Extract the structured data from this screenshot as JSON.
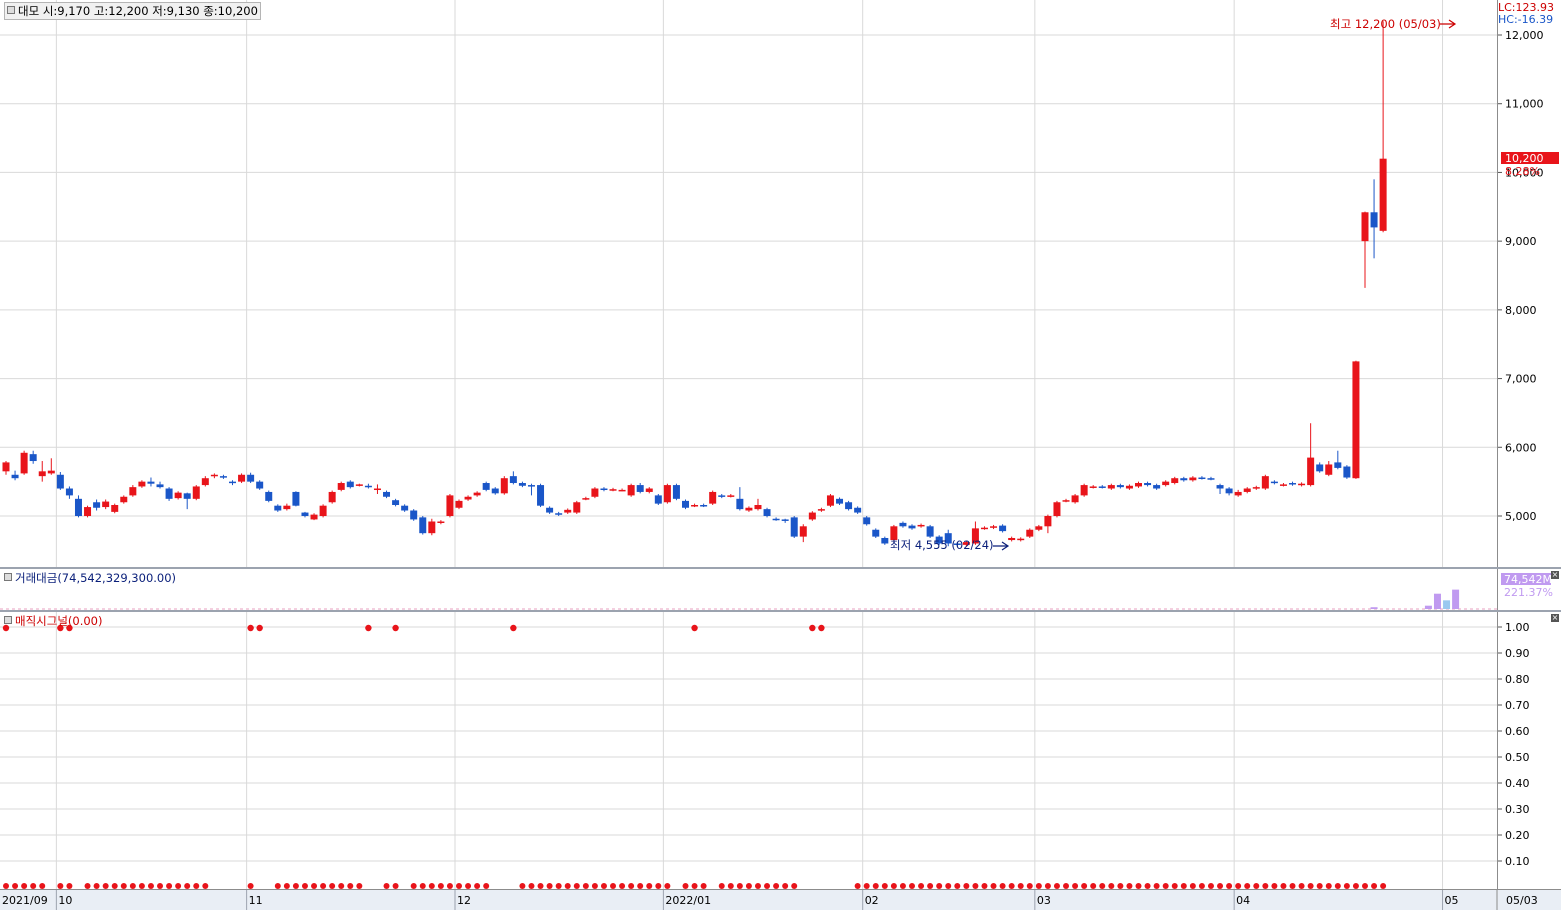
{
  "price_legend": "대모 시:9,170 고:12,200 저:9,130 종:10,200",
  "lc_label": "LC:123.93",
  "hc_label": "HC:-16.39",
  "current_price": "10,200",
  "current_change": "8.28%",
  "high_annotation": "최고 12,200 (05/03)",
  "low_annotation": "최저 4,555 (02/24)",
  "volume_title": "거래대금(74,542,329,300.00)",
  "volume_value": "74,542M",
  "volume_change": "221.37%",
  "signal_title": "매직시그널(0.00)",
  "price_axis_labels": [
    "12,000",
    "11,000",
    "10,000",
    "9,000",
    "8,000",
    "7,000",
    "6,000",
    "5,000"
  ],
  "signal_axis_labels": [
    "1.00",
    "0.90",
    "0.80",
    "0.70",
    "0.60",
    "0.50",
    "0.40",
    "0.30",
    "0.20",
    "0.10"
  ],
  "date_labels": [
    "2021/09",
    "10",
    "11",
    "12",
    "2022/01",
    "02",
    "03",
    "04",
    "05"
  ],
  "axis_date_label": "05/03",
  "colors": {
    "up": "#e8141a",
    "down": "#1a56c8",
    "grid": "#d9d9d9",
    "volume": "#c09af0",
    "volume_today": "#9ac8f0"
  },
  "chart_data": {
    "type": "candlestick",
    "ylim": [
      4400,
      12300
    ],
    "candles": [
      {
        "o": 5650,
        "c": 5780,
        "h": 5800,
        "l": 5600
      },
      {
        "o": 5600,
        "c": 5550,
        "h": 5660,
        "l": 5520
      },
      {
        "o": 5620,
        "c": 5920,
        "h": 5950,
        "l": 5600
      },
      {
        "o": 5900,
        "c": 5800,
        "h": 5950,
        "l": 5760
      },
      {
        "o": 5580,
        "c": 5650,
        "h": 5800,
        "l": 5500
      },
      {
        "o": 5620,
        "c": 5660,
        "h": 5840,
        "l": 5600
      },
      {
        "o": 5600,
        "c": 5400,
        "h": 5640,
        "l": 5380
      },
      {
        "o": 5400,
        "c": 5300,
        "h": 5430,
        "l": 5250
      },
      {
        "o": 5250,
        "c": 5000,
        "h": 5300,
        "l": 4980
      },
      {
        "o": 5000,
        "c": 5130,
        "h": 5150,
        "l": 4980
      },
      {
        "o": 5200,
        "c": 5120,
        "h": 5240,
        "l": 5080
      },
      {
        "o": 5130,
        "c": 5210,
        "h": 5240,
        "l": 5100
      },
      {
        "o": 5060,
        "c": 5160,
        "h": 5180,
        "l": 5040
      },
      {
        "o": 5200,
        "c": 5280,
        "h": 5300,
        "l": 5180
      },
      {
        "o": 5300,
        "c": 5420,
        "h": 5450,
        "l": 5280
      },
      {
        "o": 5430,
        "c": 5500,
        "h": 5520,
        "l": 5410
      },
      {
        "o": 5500,
        "c": 5470,
        "h": 5560,
        "l": 5430
      },
      {
        "o": 5460,
        "c": 5420,
        "h": 5500,
        "l": 5400
      },
      {
        "o": 5400,
        "c": 5250,
        "h": 5420,
        "l": 5220
      },
      {
        "o": 5260,
        "c": 5340,
        "h": 5360,
        "l": 5240
      },
      {
        "o": 5330,
        "c": 5250,
        "h": 5340,
        "l": 5100
      },
      {
        "o": 5250,
        "c": 5430,
        "h": 5450,
        "l": 5230
      },
      {
        "o": 5450,
        "c": 5550,
        "h": 5580,
        "l": 5430
      },
      {
        "o": 5580,
        "c": 5600,
        "h": 5620,
        "l": 5550
      },
      {
        "o": 5580,
        "c": 5570,
        "h": 5600,
        "l": 5540
      },
      {
        "o": 5500,
        "c": 5490,
        "h": 5520,
        "l": 5450
      },
      {
        "o": 5500,
        "c": 5600,
        "h": 5620,
        "l": 5480
      },
      {
        "o": 5600,
        "c": 5500,
        "h": 5630,
        "l": 5480
      },
      {
        "o": 5500,
        "c": 5400,
        "h": 5520,
        "l": 5380
      },
      {
        "o": 5350,
        "c": 5220,
        "h": 5370,
        "l": 5200
      },
      {
        "o": 5150,
        "c": 5080,
        "h": 5170,
        "l": 5060
      },
      {
        "o": 5100,
        "c": 5150,
        "h": 5180,
        "l": 5080
      },
      {
        "o": 5350,
        "c": 5150,
        "h": 5360,
        "l": 5140
      },
      {
        "o": 5050,
        "c": 5000,
        "h": 5060,
        "l": 4980
      },
      {
        "o": 4950,
        "c": 5020,
        "h": 5040,
        "l": 4940
      },
      {
        "o": 5000,
        "c": 5150,
        "h": 5170,
        "l": 4980
      },
      {
        "o": 5200,
        "c": 5350,
        "h": 5370,
        "l": 5180
      },
      {
        "o": 5380,
        "c": 5480,
        "h": 5500,
        "l": 5360
      },
      {
        "o": 5500,
        "c": 5420,
        "h": 5520,
        "l": 5400
      },
      {
        "o": 5450,
        "c": 5460,
        "h": 5470,
        "l": 5430
      },
      {
        "o": 5440,
        "c": 5420,
        "h": 5470,
        "l": 5400
      },
      {
        "o": 5400,
        "c": 5400,
        "h": 5460,
        "l": 5320
      },
      {
        "o": 5350,
        "c": 5280,
        "h": 5370,
        "l": 5260
      },
      {
        "o": 5230,
        "c": 5160,
        "h": 5250,
        "l": 5140
      },
      {
        "o": 5150,
        "c": 5080,
        "h": 5170,
        "l": 5060
      },
      {
        "o": 5080,
        "c": 4950,
        "h": 5100,
        "l": 4930
      },
      {
        "o": 4980,
        "c": 4750,
        "h": 5000,
        "l": 4730
      },
      {
        "o": 4750,
        "c": 4920,
        "h": 4960,
        "l": 4720
      },
      {
        "o": 4900,
        "c": 4920,
        "h": 4940,
        "l": 4880
      },
      {
        "o": 5000,
        "c": 5300,
        "h": 5320,
        "l": 4980
      },
      {
        "o": 5120,
        "c": 5220,
        "h": 5240,
        "l": 5100
      },
      {
        "o": 5240,
        "c": 5280,
        "h": 5300,
        "l": 5220
      },
      {
        "o": 5300,
        "c": 5340,
        "h": 5360,
        "l": 5280
      },
      {
        "o": 5480,
        "c": 5380,
        "h": 5500,
        "l": 5360
      },
      {
        "o": 5400,
        "c": 5330,
        "h": 5420,
        "l": 5310
      },
      {
        "o": 5330,
        "c": 5550,
        "h": 5580,
        "l": 5310
      },
      {
        "o": 5580,
        "c": 5480,
        "h": 5650,
        "l": 5460
      },
      {
        "o": 5480,
        "c": 5440,
        "h": 5500,
        "l": 5420
      },
      {
        "o": 5450,
        "c": 5430,
        "h": 5470,
        "l": 5300
      },
      {
        "o": 5450,
        "c": 5150,
        "h": 5470,
        "l": 5130
      },
      {
        "o": 5120,
        "c": 5050,
        "h": 5140,
        "l": 5030
      },
      {
        "o": 5040,
        "c": 5020,
        "h": 5060,
        "l": 5000
      },
      {
        "o": 5050,
        "c": 5090,
        "h": 5110,
        "l": 5030
      },
      {
        "o": 5050,
        "c": 5200,
        "h": 5220,
        "l": 5030
      },
      {
        "o": 5250,
        "c": 5260,
        "h": 5280,
        "l": 5230
      },
      {
        "o": 5280,
        "c": 5400,
        "h": 5420,
        "l": 5260
      },
      {
        "o": 5400,
        "c": 5380,
        "h": 5420,
        "l": 5360
      },
      {
        "o": 5380,
        "c": 5390,
        "h": 5410,
        "l": 5360
      },
      {
        "o": 5380,
        "c": 5380,
        "h": 5400,
        "l": 5360
      },
      {
        "o": 5300,
        "c": 5450,
        "h": 5470,
        "l": 5280
      },
      {
        "o": 5450,
        "c": 5350,
        "h": 5480,
        "l": 5330
      },
      {
        "o": 5350,
        "c": 5400,
        "h": 5420,
        "l": 5330
      },
      {
        "o": 5300,
        "c": 5180,
        "h": 5320,
        "l": 5160
      },
      {
        "o": 5200,
        "c": 5450,
        "h": 5470,
        "l": 5180
      },
      {
        "o": 5450,
        "c": 5250,
        "h": 5470,
        "l": 5230
      },
      {
        "o": 5220,
        "c": 5120,
        "h": 5240,
        "l": 5100
      },
      {
        "o": 5150,
        "c": 5160,
        "h": 5180,
        "l": 5130
      },
      {
        "o": 5160,
        "c": 5150,
        "h": 5180,
        "l": 5130
      },
      {
        "o": 5180,
        "c": 5350,
        "h": 5370,
        "l": 5160
      },
      {
        "o": 5300,
        "c": 5280,
        "h": 5320,
        "l": 5260
      },
      {
        "o": 5280,
        "c": 5300,
        "h": 5320,
        "l": 5270
      },
      {
        "o": 5250,
        "c": 5100,
        "h": 5420,
        "l": 5080
      },
      {
        "o": 5080,
        "c": 5120,
        "h": 5140,
        "l": 5060
      },
      {
        "o": 5100,
        "c": 5160,
        "h": 5250,
        "l": 5080
      },
      {
        "o": 5100,
        "c": 5000,
        "h": 5120,
        "l": 4980
      },
      {
        "o": 4960,
        "c": 4950,
        "h": 4980,
        "l": 4930
      },
      {
        "o": 4950,
        "c": 4940,
        "h": 4960,
        "l": 4900
      },
      {
        "o": 4980,
        "c": 4700,
        "h": 5000,
        "l": 4680
      },
      {
        "o": 4700,
        "c": 4850,
        "h": 4880,
        "l": 4620
      },
      {
        "o": 4950,
        "c": 5050,
        "h": 5070,
        "l": 4930
      },
      {
        "o": 5080,
        "c": 5100,
        "h": 5120,
        "l": 5060
      },
      {
        "o": 5150,
        "c": 5300,
        "h": 5320,
        "l": 5130
      },
      {
        "o": 5250,
        "c": 5180,
        "h": 5270,
        "l": 5160
      },
      {
        "o": 5200,
        "c": 5100,
        "h": 5220,
        "l": 5080
      },
      {
        "o": 5120,
        "c": 5050,
        "h": 5140,
        "l": 5030
      },
      {
        "o": 4980,
        "c": 4880,
        "h": 5000,
        "l": 4860
      },
      {
        "o": 4800,
        "c": 4700,
        "h": 4820,
        "l": 4680
      },
      {
        "o": 4680,
        "c": 4600,
        "h": 4700,
        "l": 4580
      },
      {
        "o": 4650,
        "c": 4850,
        "h": 4870,
        "l": 4630
      },
      {
        "o": 4900,
        "c": 4850,
        "h": 4920,
        "l": 4830
      },
      {
        "o": 4860,
        "c": 4820,
        "h": 4880,
        "l": 4800
      },
      {
        "o": 4850,
        "c": 4870,
        "h": 4890,
        "l": 4830
      },
      {
        "o": 4850,
        "c": 4700,
        "h": 4870,
        "l": 4680
      },
      {
        "o": 4700,
        "c": 4600,
        "h": 4720,
        "l": 4580
      },
      {
        "o": 4750,
        "c": 4600,
        "h": 4800,
        "l": 4560
      },
      {
        "o": 4600,
        "c": 4580,
        "h": 4620,
        "l": 4560
      },
      {
        "o": 4580,
        "c": 4620,
        "h": 4640,
        "l": 4560
      },
      {
        "o": 4600,
        "c": 4820,
        "h": 4920,
        "l": 4580
      },
      {
        "o": 4820,
        "c": 4830,
        "h": 4850,
        "l": 4800
      },
      {
        "o": 4830,
        "c": 4850,
        "h": 4870,
        "l": 4810
      },
      {
        "o": 4860,
        "c": 4780,
        "h": 4880,
        "l": 4760
      },
      {
        "o": 4650,
        "c": 4680,
        "h": 4700,
        "l": 4630
      },
      {
        "o": 4650,
        "c": 4670,
        "h": 4690,
        "l": 4630
      },
      {
        "o": 4700,
        "c": 4800,
        "h": 4820,
        "l": 4680
      },
      {
        "o": 4800,
        "c": 4850,
        "h": 4870,
        "l": 4780
      },
      {
        "o": 4850,
        "c": 5000,
        "h": 5020,
        "l": 4750
      },
      {
        "o": 5000,
        "c": 5200,
        "h": 5220,
        "l": 4980
      },
      {
        "o": 5220,
        "c": 5230,
        "h": 5250,
        "l": 5200
      },
      {
        "o": 5200,
        "c": 5300,
        "h": 5320,
        "l": 5180
      },
      {
        "o": 5300,
        "c": 5450,
        "h": 5470,
        "l": 5280
      },
      {
        "o": 5420,
        "c": 5430,
        "h": 5450,
        "l": 5400
      },
      {
        "o": 5430,
        "c": 5420,
        "h": 5450,
        "l": 5400
      },
      {
        "o": 5400,
        "c": 5450,
        "h": 5470,
        "l": 5380
      },
      {
        "o": 5450,
        "c": 5420,
        "h": 5470,
        "l": 5400
      },
      {
        "o": 5400,
        "c": 5440,
        "h": 5460,
        "l": 5380
      },
      {
        "o": 5430,
        "c": 5480,
        "h": 5500,
        "l": 5410
      },
      {
        "o": 5480,
        "c": 5450,
        "h": 5500,
        "l": 5430
      },
      {
        "o": 5450,
        "c": 5400,
        "h": 5470,
        "l": 5380
      },
      {
        "o": 5450,
        "c": 5500,
        "h": 5520,
        "l": 5430
      },
      {
        "o": 5480,
        "c": 5550,
        "h": 5570,
        "l": 5460
      },
      {
        "o": 5550,
        "c": 5520,
        "h": 5570,
        "l": 5500
      },
      {
        "o": 5520,
        "c": 5560,
        "h": 5580,
        "l": 5500
      },
      {
        "o": 5560,
        "c": 5550,
        "h": 5580,
        "l": 5530
      },
      {
        "o": 5550,
        "c": 5540,
        "h": 5570,
        "l": 5520
      },
      {
        "o": 5450,
        "c": 5400,
        "h": 5470,
        "l": 5320
      },
      {
        "o": 5400,
        "c": 5330,
        "h": 5420,
        "l": 5300
      },
      {
        "o": 5300,
        "c": 5350,
        "h": 5380,
        "l": 5280
      },
      {
        "o": 5350,
        "c": 5400,
        "h": 5420,
        "l": 5330
      },
      {
        "o": 5400,
        "c": 5420,
        "h": 5440,
        "l": 5380
      },
      {
        "o": 5400,
        "c": 5580,
        "h": 5600,
        "l": 5380
      },
      {
        "o": 5500,
        "c": 5480,
        "h": 5520,
        "l": 5460
      },
      {
        "o": 5450,
        "c": 5460,
        "h": 5480,
        "l": 5430
      },
      {
        "o": 5480,
        "c": 5460,
        "h": 5500,
        "l": 5440
      },
      {
        "o": 5450,
        "c": 5470,
        "h": 5490,
        "l": 5430
      },
      {
        "o": 5450,
        "c": 5850,
        "h": 6350,
        "l": 5430
      },
      {
        "o": 5750,
        "c": 5650,
        "h": 5780,
        "l": 5630
      },
      {
        "o": 5600,
        "c": 5750,
        "h": 5800,
        "l": 5580
      },
      {
        "o": 5780,
        "c": 5700,
        "h": 5950,
        "l": 5680
      },
      {
        "o": 5720,
        "c": 5560,
        "h": 5740,
        "l": 5540
      },
      {
        "o": 5550,
        "c": 7250,
        "h": 7260,
        "l": 5540
      },
      {
        "o": 9000,
        "c": 9420,
        "h": 9430,
        "l": 8320
      },
      {
        "o": 9420,
        "c": 9200,
        "h": 9900,
        "l": 8750
      },
      {
        "o": 9150,
        "c": 10200,
        "h": 12200,
        "l": 9130
      }
    ]
  },
  "volume_data": {
    "ylim": [
      0,
      74542
    ],
    "bars": [
      {
        "i": 151,
        "v": 3500
      },
      {
        "i": 157,
        "v": 6500
      },
      {
        "i": 158,
        "v": 30000
      },
      {
        "i": 159,
        "v": 17000
      },
      {
        "i": 160,
        "v": 38000
      }
    ]
  },
  "signal_data": {
    "ylim": [
      0,
      1.05
    ],
    "ones": [
      0,
      6,
      7,
      27,
      28,
      40,
      43,
      56,
      76,
      89,
      90
    ],
    "zero_gaps": [
      5,
      8,
      23,
      24,
      25,
      26,
      28,
      29,
      40,
      41,
      44,
      54,
      55,
      56,
      74,
      78,
      88,
      89,
      90,
      91,
      92,
      93
    ]
  }
}
